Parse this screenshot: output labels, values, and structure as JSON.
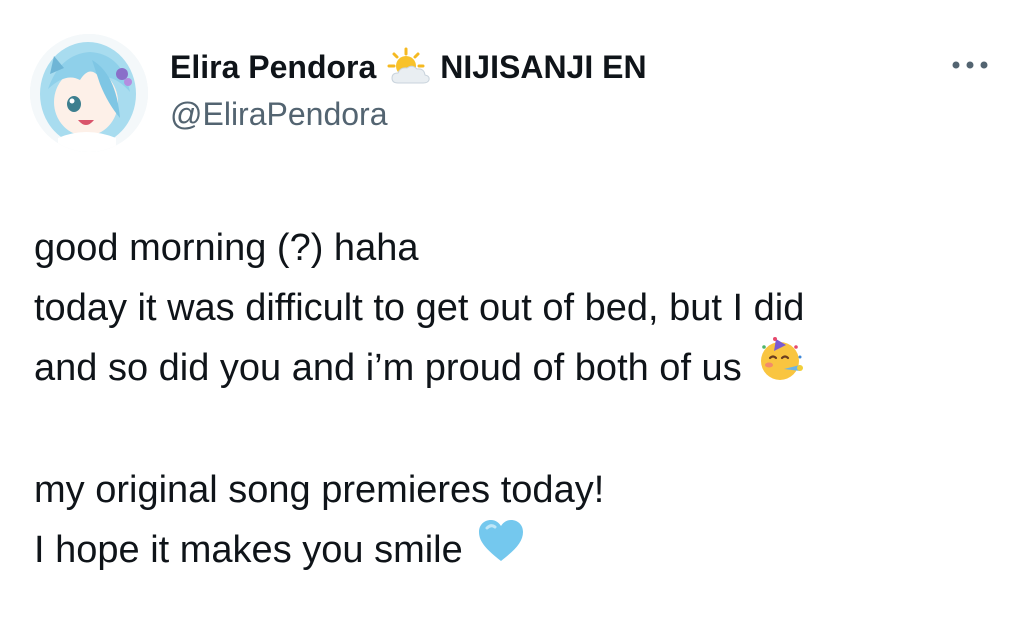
{
  "author": {
    "display_name": "Elira Pendora",
    "badge_icon": "sun-behind-cloud-icon",
    "affiliation": "NIJISANJI EN",
    "handle": "@EliraPendora",
    "avatar_icon": "profile-avatar"
  },
  "menu": {
    "icon": "more-options-icon"
  },
  "tweet": {
    "lines": [
      "good morning (?) haha",
      "today it was difficult to get out of bed, but I did",
      "and so did you and i’m proud of both of us",
      "my original song premieres today!",
      "I hope it makes you smile"
    ],
    "emojis": {
      "line3": "partying-face-icon",
      "line5": "light-blue-heart-icon"
    }
  },
  "colors": {
    "text": "#0f1419",
    "secondary": "#536471",
    "heart": "#74c8ee",
    "hair": "#a8dcef"
  }
}
